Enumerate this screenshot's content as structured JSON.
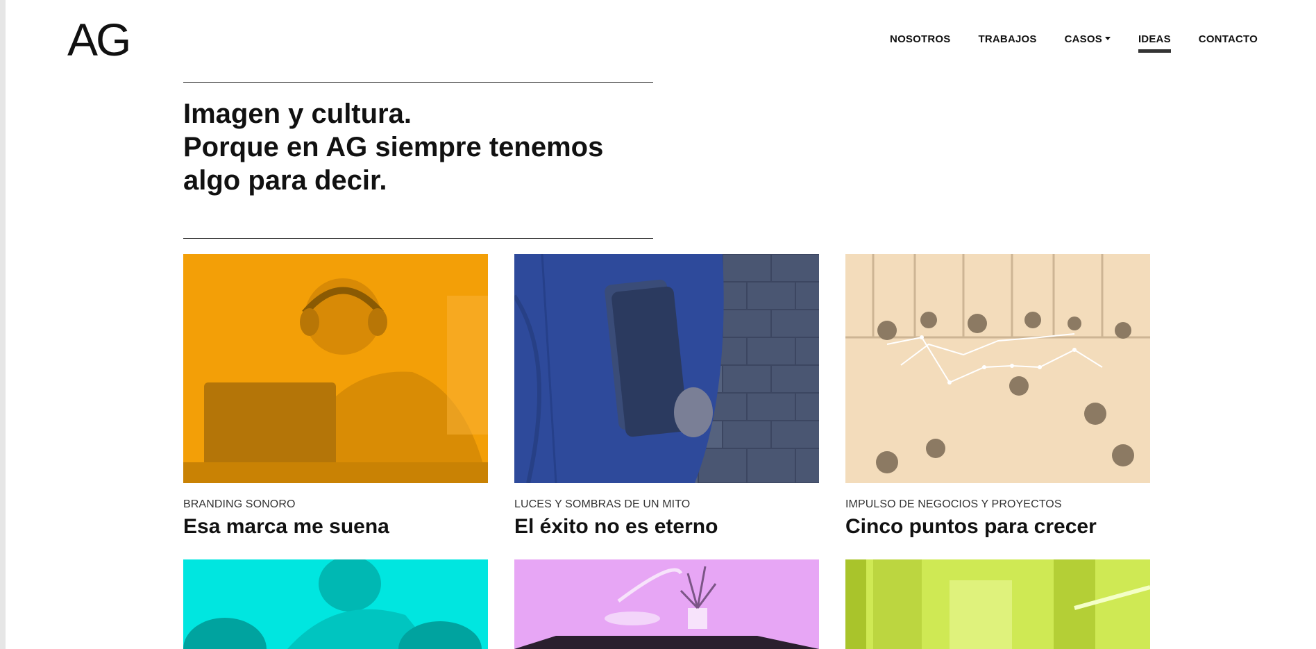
{
  "brand": {
    "logo_text": "AG"
  },
  "nav": {
    "items": [
      {
        "label": "NOSOTROS",
        "active": false,
        "dropdown": false
      },
      {
        "label": "TRABAJOS",
        "active": false,
        "dropdown": false
      },
      {
        "label": "CASOS",
        "active": false,
        "dropdown": true
      },
      {
        "label": "IDEAS",
        "active": true,
        "dropdown": false
      },
      {
        "label": "CONTACTO",
        "active": false,
        "dropdown": false
      }
    ]
  },
  "hero": {
    "lines": [
      "Imagen y cultura.",
      "Porque en AG siempre tenemos",
      "algo para decir."
    ]
  },
  "cards": [
    {
      "kicker": "BRANDING SONORO",
      "title": "Esa marca me suena",
      "tint": "#f9a50b",
      "image": "woman-headphones-laptop"
    },
    {
      "kicker": "LUCES Y SOMBRAS DE UN MITO",
      "title": "El éxito no es eterno",
      "tint": "#3a57a8",
      "image": "man-suit-laptop-brick"
    },
    {
      "kicker": "IMPULSO DE NEGOCIOS Y PROYECTOS",
      "title": "Cinco puntos para crecer",
      "tint": "#f3dcbb",
      "image": "office-aerial-graph"
    }
  ],
  "lower_cards": [
    {
      "tint": "#00e6e0",
      "image": "people-meeting"
    },
    {
      "tint": "#e7a6f5",
      "image": "desk-plant-lamp"
    },
    {
      "tint": "#cfe954",
      "image": "abstract-architecture"
    }
  ]
}
